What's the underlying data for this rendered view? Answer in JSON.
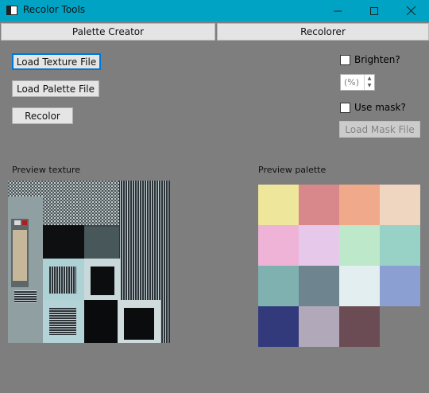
{
  "window": {
    "title": "Recolor Tools",
    "icon": "app-window-icon",
    "controls": [
      "minimize-icon",
      "maximize-icon",
      "close-icon"
    ]
  },
  "tabs": [
    {
      "label": "Palette Creator"
    },
    {
      "label": "Recolorer"
    }
  ],
  "buttons": {
    "load_texture": "Load Texture File",
    "load_palette": "Load Palette File",
    "recolor": "Recolor",
    "load_mask": "Load Mask File"
  },
  "options": {
    "brighten_label": "Brighten?",
    "brighten_checked": false,
    "percent_placeholder": "(%)",
    "use_mask_label": "Use mask?",
    "use_mask_checked": false
  },
  "labels": {
    "preview_texture": "Preview texture",
    "preview_palette": "Preview palette"
  },
  "palette_colors": [
    "#ede69b",
    "#d8878a",
    "#f1a98b",
    "#efd6c1",
    "#eeb3d6",
    "#e6c8ea",
    "#bde8c9",
    "#98d2c6",
    "#7fb1b0",
    "#6e8590",
    "#e3eef1",
    "#8c9fd3",
    "#323a7c",
    "#b1a9ba",
    "#6b4b54"
  ],
  "colors": {
    "titlebar": "#00a3c4",
    "background": "#7e7e7e",
    "focus_border": "#0078d7"
  }
}
